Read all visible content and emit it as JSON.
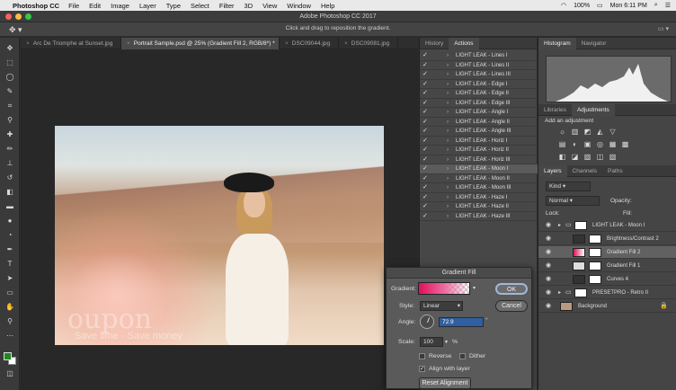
{
  "menubar": {
    "app": "Photoshop CC",
    "items": [
      "File",
      "Edit",
      "Image",
      "Layer",
      "Type",
      "Select",
      "Filter",
      "3D",
      "View",
      "Window",
      "Help"
    ],
    "battery": "100%",
    "clock": "Mon 6:11 PM"
  },
  "window": {
    "title": "Adobe Photoshop CC 2017"
  },
  "options": {
    "hint": "Click and drag to reposition the gradient."
  },
  "doc_tabs": [
    {
      "label": "Arc De Triomphe at Sunset.jpg"
    },
    {
      "label": "Portrait Sample.psd @ 25% (Gradient Fill 2, RGB/8*) *"
    },
    {
      "label": "DSC09044.jpg"
    },
    {
      "label": "DSC09081.jpg"
    }
  ],
  "photo": {
    "watermark": "oupon",
    "watermark_tag": "Save time - Save money"
  },
  "actions_panel": {
    "tabs": [
      "History",
      "Actions"
    ],
    "items": [
      "LIGHT LEAK - Lines I",
      "LIGHT LEAK - Lines II",
      "LIGHT LEAK - Lines III",
      "LIGHT LEAK - Edge I",
      "LIGHT LEAK - Edge II",
      "LIGHT LEAK - Edge III",
      "LIGHT LEAK - Angle I",
      "LIGHT LEAK - Angle II",
      "LIGHT LEAK - Angle III",
      "LIGHT LEAK - Horiz I",
      "LIGHT LEAK - Horiz II",
      "LIGHT LEAK - Horiz III",
      "LIGHT LEAK - Moon I",
      "LIGHT LEAK - Moon II",
      "LIGHT LEAK - Moon III",
      "LIGHT LEAK - Haze I",
      "LIGHT LEAK - Haze II",
      "LIGHT LEAK - Haze III"
    ],
    "selected_index": 12
  },
  "right_panel": {
    "top_tabs": [
      "Histogram",
      "Navigator"
    ],
    "mid_tabs": [
      "Libraries",
      "Adjustments"
    ],
    "adjust_label": "Add an adjustment",
    "layer_tabs": [
      "Layers",
      "Channels",
      "Paths"
    ],
    "filter_kind": "Kind",
    "blend_mode": "Normal",
    "opacity_label": "Opacity:",
    "fill_label": "Fill:",
    "lock_label": "Lock:",
    "layers": [
      {
        "name": "LIGHT LEAK - Moon I",
        "type": "group"
      },
      {
        "name": "Brightness/Contrast 2",
        "type": "adjust"
      },
      {
        "name": "Gradient Fill 2",
        "type": "fill",
        "selected": true
      },
      {
        "name": "Gradient Fill 1",
        "type": "fill"
      },
      {
        "name": "Curves 4",
        "type": "adjust"
      },
      {
        "name": "PRESETPRO - Retro II",
        "type": "group"
      },
      {
        "name": "Background",
        "type": "background"
      }
    ]
  },
  "dialog": {
    "title": "Gradient Fill",
    "gradient_label": "Gradient:",
    "style_label": "Style:",
    "style_value": "Linear",
    "angle_label": "Angle:",
    "angle_value": "72.9",
    "scale_label": "Scale:",
    "scale_value": "100",
    "scale_unit": "%",
    "reverse_label": "Reverse",
    "dither_label": "Dither",
    "align_label": "Align with layer",
    "reset_label": "Reset Alignment",
    "ok_label": "OK",
    "cancel_label": "Cancel",
    "reverse_checked": false,
    "dither_checked": false,
    "align_checked": true
  },
  "colors": {
    "foreground": "#1e8a1e",
    "background": "#ffffff",
    "gradient_start": "#e0105a",
    "accent_ok": "#9fb8d8"
  }
}
